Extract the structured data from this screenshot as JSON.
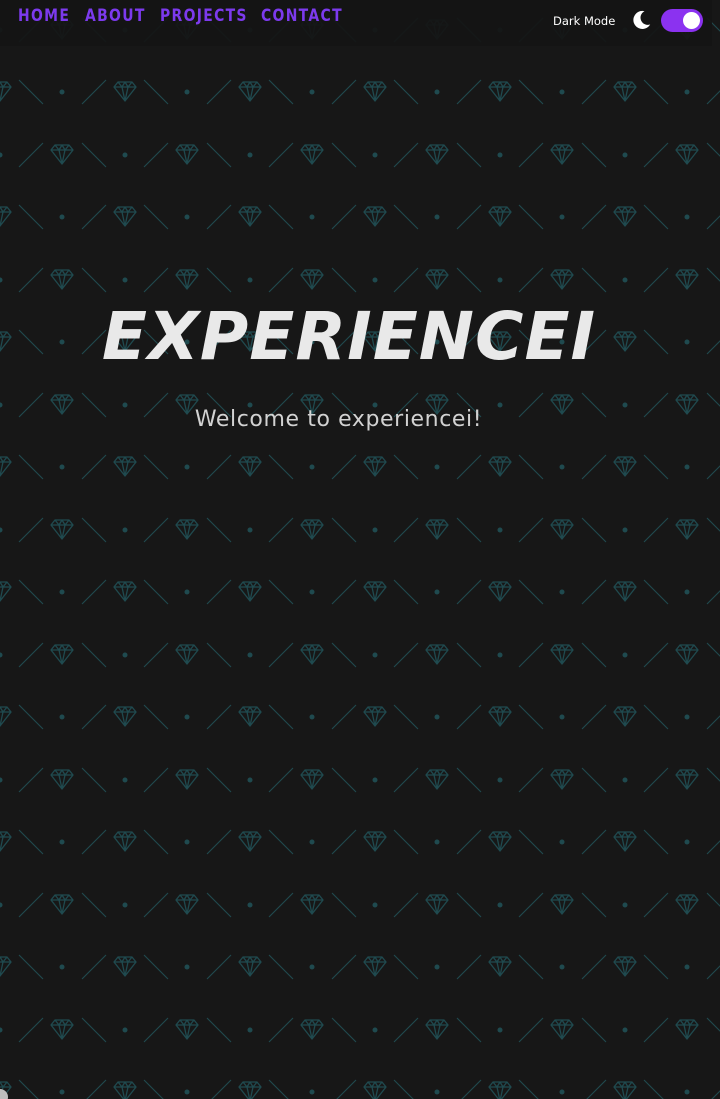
{
  "nav": {
    "links": [
      {
        "label": "HOME"
      },
      {
        "label": "ABOUT"
      },
      {
        "label": "PROJECTS"
      },
      {
        "label": "CONTACT"
      }
    ],
    "link_color": "#7c3aed"
  },
  "theme_toggle": {
    "label": "Dark Mode",
    "icon": "moon-icon",
    "enabled": true,
    "accent_color": "#8b32f0"
  },
  "hero": {
    "title": "EXPERIENCEI",
    "subtitle": "Welcome to experiencei!"
  },
  "background": {
    "color": "#171717",
    "pattern_color": "#1f4a4f",
    "pattern_icon": "diamond-icon"
  }
}
